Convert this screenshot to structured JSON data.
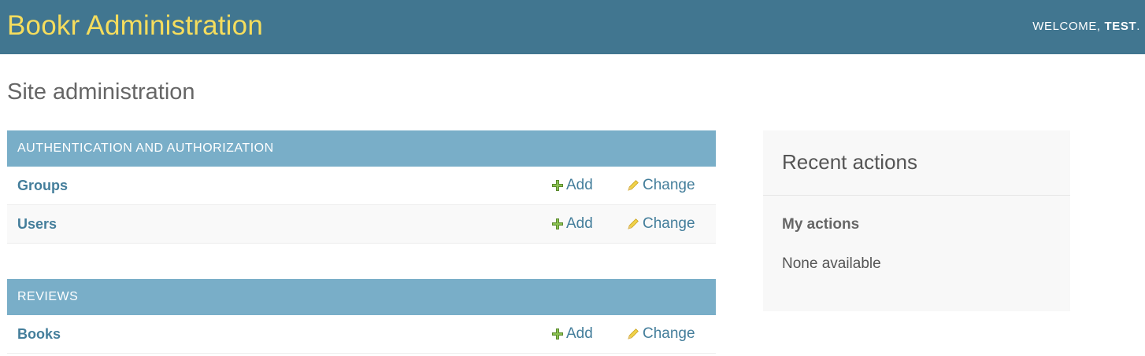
{
  "header": {
    "branding": "Bookr Administration",
    "welcome_prefix": "WELCOME, ",
    "username": "TEST",
    "welcome_suffix": "."
  },
  "page_title": "Site administration",
  "modules": [
    {
      "caption": "AUTHENTICATION AND AUTHORIZATION",
      "models": [
        {
          "name": "Groups",
          "add": "Add",
          "change": "Change"
        },
        {
          "name": "Users",
          "add": "Add",
          "change": "Change"
        }
      ]
    },
    {
      "caption": "REVIEWS",
      "models": [
        {
          "name": "Books",
          "add": "Add",
          "change": "Change"
        }
      ]
    }
  ],
  "recent_actions": {
    "title": "Recent actions",
    "my_actions": "My actions",
    "empty": "None available"
  },
  "colors": {
    "header_bg": "#417690",
    "branding": "#f5dd5d",
    "caption_bg": "#79aec8",
    "link": "#447e9b",
    "add_icon": "#70bf2b",
    "change_icon": "#efb80b"
  },
  "icons": {
    "add": "plus-icon",
    "change": "pencil-icon"
  }
}
